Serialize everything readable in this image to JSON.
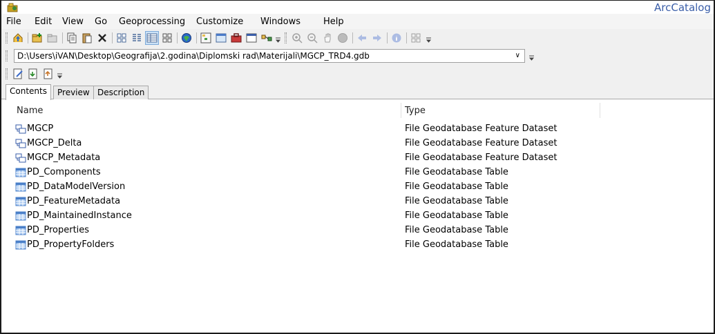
{
  "window": {
    "title": "ArcCatalog"
  },
  "menu": [
    "File",
    "Edit",
    "View",
    "Go",
    "Geoprocessing",
    "Customize",
    "Windows",
    "Help"
  ],
  "location": {
    "value": "D:\\Users\\iVAN\\Desktop\\Geografija\\2.godina\\Diplomski rad\\Materijali\\MGCP_TRD4.gdb"
  },
  "tabs": [
    {
      "label": "Contents",
      "active": true
    },
    {
      "label": "Preview",
      "active": false
    },
    {
      "label": "Description",
      "active": false
    }
  ],
  "columns": {
    "name": "Name",
    "type": "Type"
  },
  "rows": [
    {
      "name": "MGCP",
      "type": "File Geodatabase Feature Dataset",
      "icon": "feature-dataset-icon"
    },
    {
      "name": "MGCP_Delta",
      "type": "File Geodatabase Feature Dataset",
      "icon": "feature-dataset-icon"
    },
    {
      "name": "MGCP_Metadata",
      "type": "File Geodatabase Feature Dataset",
      "icon": "feature-dataset-icon"
    },
    {
      "name": "PD_Components",
      "type": "File Geodatabase Table",
      "icon": "table-icon"
    },
    {
      "name": "PD_DataModelVersion",
      "type": "File Geodatabase Table",
      "icon": "table-icon"
    },
    {
      "name": "PD_FeatureMetadata",
      "type": "File Geodatabase Table",
      "icon": "table-icon"
    },
    {
      "name": "PD_MaintainedInstance",
      "type": "File Geodatabase Table",
      "icon": "table-icon"
    },
    {
      "name": "PD_Properties",
      "type": "File Geodatabase Table",
      "icon": "table-icon"
    },
    {
      "name": "PD_PropertyFolders",
      "type": "File Geodatabase Table",
      "icon": "table-icon"
    }
  ],
  "colors": {
    "title": "#3a5ea8",
    "table_icon": "#4a7fc8"
  }
}
